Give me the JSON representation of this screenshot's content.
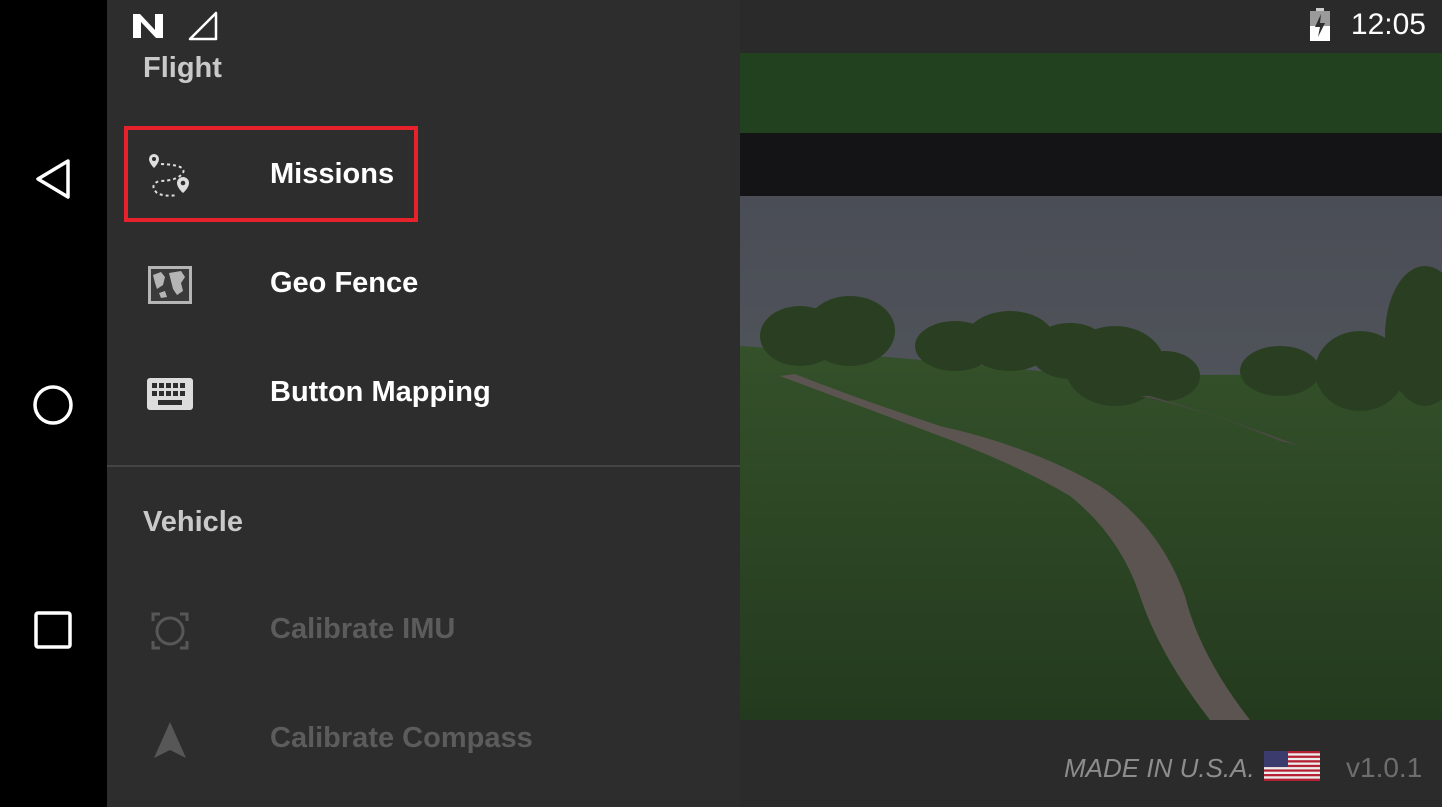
{
  "status_bar": {
    "time": "12:05"
  },
  "nav": {
    "back": "back-icon",
    "home": "home-icon",
    "recents": "recents-icon"
  },
  "drawer": {
    "sections": [
      {
        "title": "Flight",
        "items": [
          {
            "label": "Missions",
            "icon": "missions-route-icon",
            "enabled": true,
            "highlighted": true
          },
          {
            "label": "Geo Fence",
            "icon": "map-icon",
            "enabled": true
          },
          {
            "label": "Button Mapping",
            "icon": "keyboard-icon",
            "enabled": true
          }
        ]
      },
      {
        "title": "Vehicle",
        "items": [
          {
            "label": "Calibrate IMU",
            "icon": "imu-icon",
            "enabled": false
          },
          {
            "label": "Calibrate Compass",
            "icon": "compass-arrow-icon",
            "enabled": false
          }
        ]
      }
    ]
  },
  "footer": {
    "made_in": "MADE IN U.S.A.",
    "version": "v1.0.1"
  },
  "colors": {
    "highlight": "#e8222a",
    "header_green": "#22421f",
    "drawer_bg": "#2d2d2d"
  }
}
